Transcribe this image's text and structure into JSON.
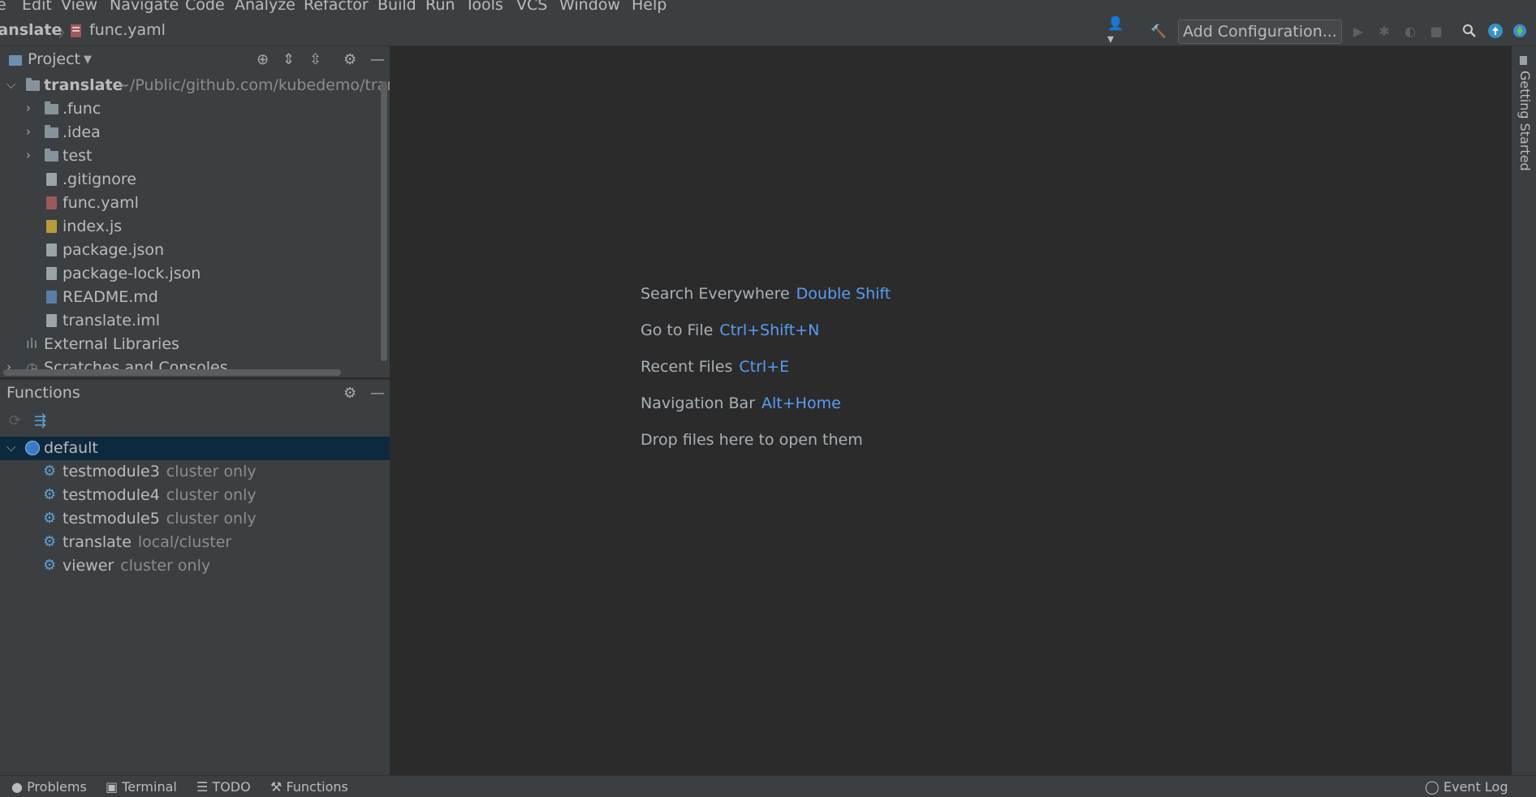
{
  "menu": [
    "e",
    "Edit",
    "View",
    "Navigate",
    "Code",
    "Analyze",
    "Refactor",
    "Build",
    "Run",
    "Tools",
    "VCS",
    "Window",
    "Help"
  ],
  "breadcrumb": {
    "project": "ranslate",
    "file": "func.yaml"
  },
  "toolbar": {
    "add_configuration": "Add Configuration..."
  },
  "project_panel": {
    "title": "Project",
    "root": {
      "name": "translate",
      "path": "~/Public/github.com/kubedemo/transl"
    },
    "folders": [
      ".func",
      ".idea",
      "test"
    ],
    "files": [
      ".gitignore",
      "func.yaml",
      "index.js",
      "package.json",
      "package-lock.json",
      "README.md",
      "translate.iml"
    ],
    "external": "External Libraries",
    "scratches": "Scratches and Consoles"
  },
  "functions_panel": {
    "title": "Functions",
    "namespace": "default",
    "items": [
      {
        "name": "testmodule3",
        "mode": "cluster only"
      },
      {
        "name": "testmodule4",
        "mode": "cluster only"
      },
      {
        "name": "testmodule5",
        "mode": "cluster only"
      },
      {
        "name": "translate",
        "mode": "local/cluster"
      },
      {
        "name": "viewer",
        "mode": "cluster only"
      }
    ]
  },
  "editor_hints": [
    {
      "label": "Search Everywhere",
      "key": "Double Shift"
    },
    {
      "label": "Go to File",
      "key": "Ctrl+Shift+N"
    },
    {
      "label": "Recent Files",
      "key": "Ctrl+E"
    },
    {
      "label": "Navigation Bar",
      "key": "Alt+Home"
    },
    {
      "label": "Drop files here to open them",
      "key": ""
    }
  ],
  "right_strip": {
    "getting_started": "Getting Started"
  },
  "statusbar": {
    "problems": "Problems",
    "terminal": "Terminal",
    "todo": "TODO",
    "functions": "Functions",
    "event_log": "Event Log"
  },
  "colors": {
    "background": "#2b2b2b",
    "panel": "#3c3f41",
    "accent": "#589df6",
    "selection": "#0d293e"
  }
}
